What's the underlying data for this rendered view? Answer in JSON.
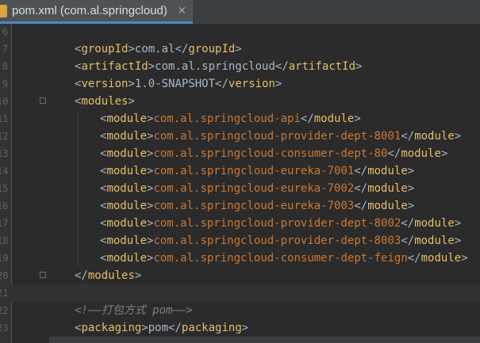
{
  "tab": {
    "label": "pom.xml (com.al.springcloud)",
    "close": "×"
  },
  "colors": {
    "tag": "#e8bf6a",
    "bracket": "#a9b7c6",
    "module_value": "#cc7832",
    "comment": "#808080"
  },
  "lines": [
    {
      "n": "6"
    },
    {
      "n": "7",
      "tag": "groupId",
      "value": "com.al"
    },
    {
      "n": "8",
      "tag": "artifactId",
      "value": "com.al.springcloud"
    },
    {
      "n": "9",
      "tag": "version",
      "value": "1.0-SNAPSHOT"
    },
    {
      "n": "10",
      "tag": "modules"
    },
    {
      "n": "11",
      "tag": "module",
      "value": "com.al.springcloud-api"
    },
    {
      "n": "12",
      "tag": "module",
      "value": "com.al.springcloud-provider-dept-8001"
    },
    {
      "n": "13",
      "tag": "module",
      "value": "com.al.springcloud-consumer-dept-80"
    },
    {
      "n": "14",
      "tag": "module",
      "value": "com.al.springcloud-eureka-7001"
    },
    {
      "n": "15",
      "tag": "module",
      "value": "com.al.springcloud-eureka-7002"
    },
    {
      "n": "16",
      "tag": "module",
      "value": "com.al.springcloud-eureka-7003"
    },
    {
      "n": "17",
      "tag": "module",
      "value": "com.al.springcloud-provider-dept-8002"
    },
    {
      "n": "18",
      "tag": "module",
      "value": "com.al.springcloud-provider-dept-8003"
    },
    {
      "n": "19",
      "tag": "module",
      "value": "com.al.springcloud-consumer-dept-feign"
    },
    {
      "n": "20",
      "tag": "modules"
    },
    {
      "n": "21"
    },
    {
      "n": "22",
      "comment": "<!——打包方式  pom——>"
    },
    {
      "n": "23",
      "tag": "packaging",
      "value": "pom"
    }
  ]
}
